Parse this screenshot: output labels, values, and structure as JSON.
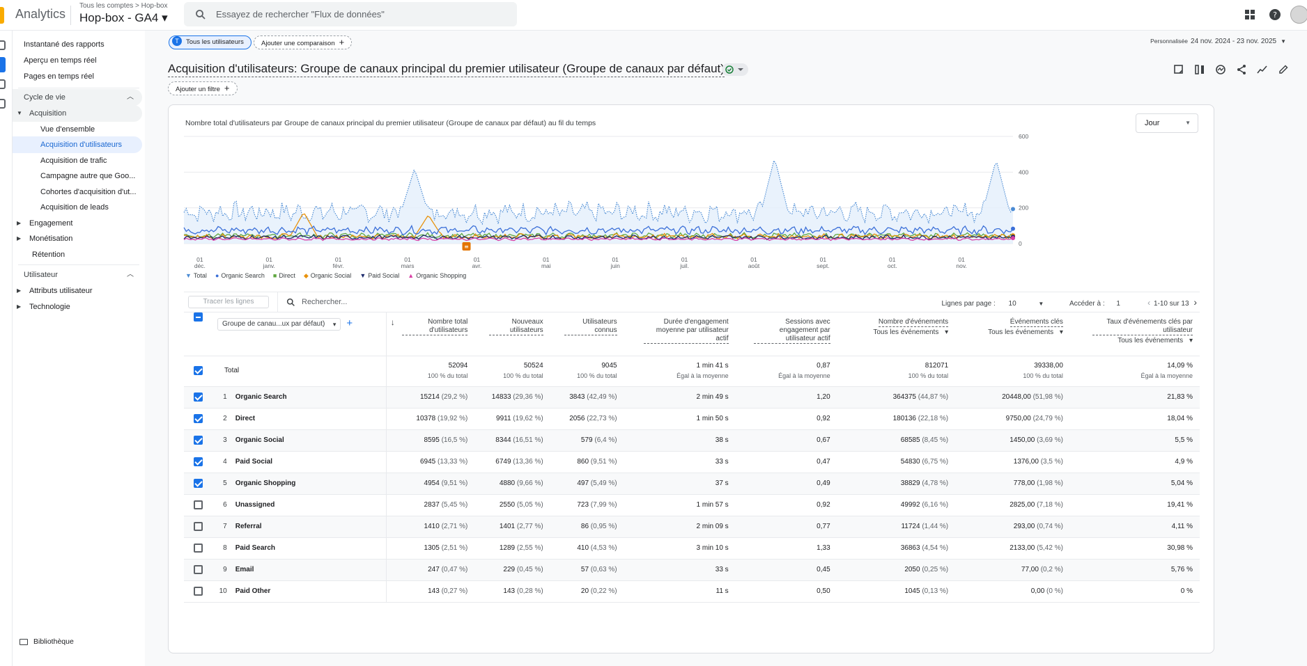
{
  "header": {
    "app_name": "Analytics",
    "breadcrumb": "Tous les comptes > Hop-box",
    "property": "Hop-box  - GA4 ▾",
    "search_placeholder": "Essayez de rechercher \"Flux de données\""
  },
  "sidebar": {
    "items": [
      {
        "label": "Instantané des rapports"
      },
      {
        "label": "Aperçu en temps réel"
      },
      {
        "label": "Pages en temps réel"
      }
    ],
    "lifecycle_header": "Cycle de vie",
    "acquisition": "Acquisition",
    "acquisition_items": [
      {
        "label": "Vue d'ensemble"
      },
      {
        "label": "Acquisition d'utilisateurs"
      },
      {
        "label": "Acquisition de trafic"
      },
      {
        "label": "Campagne autre que Goo..."
      },
      {
        "label": "Cohortes d'acquisition d'ut..."
      },
      {
        "label": "Acquisition de leads"
      }
    ],
    "engagement": "Engagement",
    "monetisation": "Monétisation",
    "retention": "Rétention",
    "user_header": "Utilisateur",
    "user_attributes": "Attributs utilisateur",
    "technology": "Technologie",
    "library": "Bibliothèque"
  },
  "toolbar": {
    "all_users_chip": "Tous les utilisateurs",
    "all_users_initial": "T",
    "add_comparison": "Ajouter une comparaison",
    "date_label": "Personnalisée",
    "date_range": "24 nov. 2024 - 23 nov. 2025",
    "add_filter": "Ajouter un filtre"
  },
  "page_title": "Acquisition d'utilisateurs: Groupe de canaux principal du premier utilisateur (Groupe de canaux par défaut)",
  "chart": {
    "title": "Nombre total d'utilisateurs par Groupe de canaux principal du premier utilisateur (Groupe de canaux par défaut) au fil du temps",
    "granularity": "Jour",
    "annotation_marker": "≡"
  },
  "chart_data": {
    "type": "line",
    "x_ticks": [
      {
        "day": "01",
        "month": "déc."
      },
      {
        "day": "01",
        "month": "janv."
      },
      {
        "day": "01",
        "month": "févr."
      },
      {
        "day": "01",
        "month": "mars"
      },
      {
        "day": "01",
        "month": "avr."
      },
      {
        "day": "01",
        "month": "mai"
      },
      {
        "day": "01",
        "month": "juin"
      },
      {
        "day": "01",
        "month": "juil."
      },
      {
        "day": "01",
        "month": "août"
      },
      {
        "day": "01",
        "month": "sept."
      },
      {
        "day": "01",
        "month": "oct."
      },
      {
        "day": "01",
        "month": "nov."
      }
    ],
    "y_ticks": [
      "600",
      "400",
      "200",
      "0"
    ],
    "ylim": [
      0,
      600
    ],
    "series": [
      {
        "name": "Total",
        "color": "#4b8bd4",
        "style": "dotted",
        "filled": true,
        "approx_level": 175,
        "peaks": [
          {
            "month_index": 3.1,
            "value": 420
          },
          {
            "month_index": 8.3,
            "value": 480
          },
          {
            "month_index": 11.5,
            "value": 470
          }
        ]
      },
      {
        "name": "Organic Search",
        "color": "#3b6fd8",
        "approx_level": 75
      },
      {
        "name": "Direct",
        "color": "#5fa73f",
        "approx_level": 45
      },
      {
        "name": "Organic Social",
        "color": "#e8920c",
        "approx_level": 40,
        "peaks": [
          {
            "month_index": 1.5,
            "value": 175
          },
          {
            "month_index": 3.3,
            "value": 160
          }
        ]
      },
      {
        "name": "Paid Social",
        "color": "#1c2a6b",
        "approx_level": 35
      },
      {
        "name": "Organic Shopping",
        "color": "#d83ea4",
        "approx_level": 25
      }
    ]
  },
  "table": {
    "trace_button": "Tracer les lignes",
    "search_placeholder": "Rechercher...",
    "rows_per_page_label": "Lignes par page :",
    "rows_per_page": "10",
    "goto_label": "Accéder à :",
    "goto_value": "1",
    "range": "1-10 sur 13",
    "dimension_label": "Groupe de canau...ux par défaut)",
    "headers": [
      {
        "label": "Nombre total d'utilisateurs"
      },
      {
        "label": "Nouveaux utilisateurs"
      },
      {
        "label": "Utilisateurs connus"
      },
      {
        "label": "Durée d'engagement moyenne par utilisateur actif"
      },
      {
        "label": "Sessions avec engagement par utilisateur actif"
      },
      {
        "label": "Nombre d'événements",
        "select": "Tous les événements"
      },
      {
        "label": "Événements clés",
        "select": "Tous les événements"
      },
      {
        "label": "Taux d'événements clés par utilisateur",
        "select": "Tous les événements"
      }
    ],
    "total": {
      "label": "Total",
      "values": [
        "52094",
        "50524",
        "9045",
        "1 min 41 s",
        "0,87",
        "812071",
        "39338,00",
        "14,09 %"
      ],
      "subs": [
        "100 % du total",
        "100 % du total",
        "100 % du total",
        "Égal à la moyenne",
        "Égal à la moyenne",
        "100 % du total",
        "100 % du total",
        "Égal à la moyenne"
      ]
    },
    "rows": [
      {
        "num": "1",
        "name": "Organic Search",
        "checked": true,
        "cells": [
          [
            "15214",
            "(29,2 %)"
          ],
          [
            "14833",
            "(29,36 %)"
          ],
          [
            "3843",
            "(42,49 %)"
          ],
          [
            "2 min 49 s",
            ""
          ],
          [
            "1,20",
            ""
          ],
          [
            "364375",
            "(44,87 %)"
          ],
          [
            "20448,00",
            "(51,98 %)"
          ],
          [
            "21,83 %",
            ""
          ]
        ]
      },
      {
        "num": "2",
        "name": "Direct",
        "checked": true,
        "cells": [
          [
            "10378",
            "(19,92 %)"
          ],
          [
            "9911",
            "(19,62 %)"
          ],
          [
            "2056",
            "(22,73 %)"
          ],
          [
            "1 min 50 s",
            ""
          ],
          [
            "0,92",
            ""
          ],
          [
            "180136",
            "(22,18 %)"
          ],
          [
            "9750,00",
            "(24,79 %)"
          ],
          [
            "18,04 %",
            ""
          ]
        ]
      },
      {
        "num": "3",
        "name": "Organic Social",
        "checked": true,
        "cells": [
          [
            "8595",
            "(16,5 %)"
          ],
          [
            "8344",
            "(16,51 %)"
          ],
          [
            "579",
            "(6,4 %)"
          ],
          [
            "38 s",
            ""
          ],
          [
            "0,67",
            ""
          ],
          [
            "68585",
            "(8,45 %)"
          ],
          [
            "1450,00",
            "(3,69 %)"
          ],
          [
            "5,5 %",
            ""
          ]
        ]
      },
      {
        "num": "4",
        "name": "Paid Social",
        "checked": true,
        "cells": [
          [
            "6945",
            "(13,33 %)"
          ],
          [
            "6749",
            "(13,36 %)"
          ],
          [
            "860",
            "(9,51 %)"
          ],
          [
            "33 s",
            ""
          ],
          [
            "0,47",
            ""
          ],
          [
            "54830",
            "(6,75 %)"
          ],
          [
            "1376,00",
            "(3,5 %)"
          ],
          [
            "4,9 %",
            ""
          ]
        ]
      },
      {
        "num": "5",
        "name": "Organic Shopping",
        "checked": true,
        "cells": [
          [
            "4954",
            "(9,51 %)"
          ],
          [
            "4880",
            "(9,66 %)"
          ],
          [
            "497",
            "(5,49 %)"
          ],
          [
            "37 s",
            ""
          ],
          [
            "0,49",
            ""
          ],
          [
            "38829",
            "(4,78 %)"
          ],
          [
            "778,00",
            "(1,98 %)"
          ],
          [
            "5,04 %",
            ""
          ]
        ]
      },
      {
        "num": "6",
        "name": "Unassigned",
        "checked": false,
        "cells": [
          [
            "2837",
            "(5,45 %)"
          ],
          [
            "2550",
            "(5,05 %)"
          ],
          [
            "723",
            "(7,99 %)"
          ],
          [
            "1 min 57 s",
            ""
          ],
          [
            "0,92",
            ""
          ],
          [
            "49992",
            "(6,16 %)"
          ],
          [
            "2825,00",
            "(7,18 %)"
          ],
          [
            "19,41 %",
            ""
          ]
        ]
      },
      {
        "num": "7",
        "name": "Referral",
        "checked": false,
        "cells": [
          [
            "1410",
            "(2,71 %)"
          ],
          [
            "1401",
            "(2,77 %)"
          ],
          [
            "86",
            "(0,95 %)"
          ],
          [
            "2 min 09 s",
            ""
          ],
          [
            "0,77",
            ""
          ],
          [
            "11724",
            "(1,44 %)"
          ],
          [
            "293,00",
            "(0,74 %)"
          ],
          [
            "4,11 %",
            ""
          ]
        ]
      },
      {
        "num": "8",
        "name": "Paid Search",
        "checked": false,
        "cells": [
          [
            "1305",
            "(2,51 %)"
          ],
          [
            "1289",
            "(2,55 %)"
          ],
          [
            "410",
            "(4,53 %)"
          ],
          [
            "3 min 10 s",
            ""
          ],
          [
            "1,33",
            ""
          ],
          [
            "36863",
            "(4,54 %)"
          ],
          [
            "2133,00",
            "(5,42 %)"
          ],
          [
            "30,98 %",
            ""
          ]
        ]
      },
      {
        "num": "9",
        "name": "Email",
        "checked": false,
        "cells": [
          [
            "247",
            "(0,47 %)"
          ],
          [
            "229",
            "(0,45 %)"
          ],
          [
            "57",
            "(0,63 %)"
          ],
          [
            "33 s",
            ""
          ],
          [
            "0,45",
            ""
          ],
          [
            "2050",
            "(0,25 %)"
          ],
          [
            "77,00",
            "(0,2 %)"
          ],
          [
            "5,76 %",
            ""
          ]
        ]
      },
      {
        "num": "10",
        "name": "Paid Other",
        "checked": false,
        "cells": [
          [
            "143",
            "(0,27 %)"
          ],
          [
            "143",
            "(0,28 %)"
          ],
          [
            "20",
            "(0,22 %)"
          ],
          [
            "11 s",
            ""
          ],
          [
            "0,50",
            ""
          ],
          [
            "1045",
            "(0,13 %)"
          ],
          [
            "0,00",
            "(0 %)"
          ],
          [
            "0 %",
            ""
          ]
        ]
      }
    ]
  }
}
